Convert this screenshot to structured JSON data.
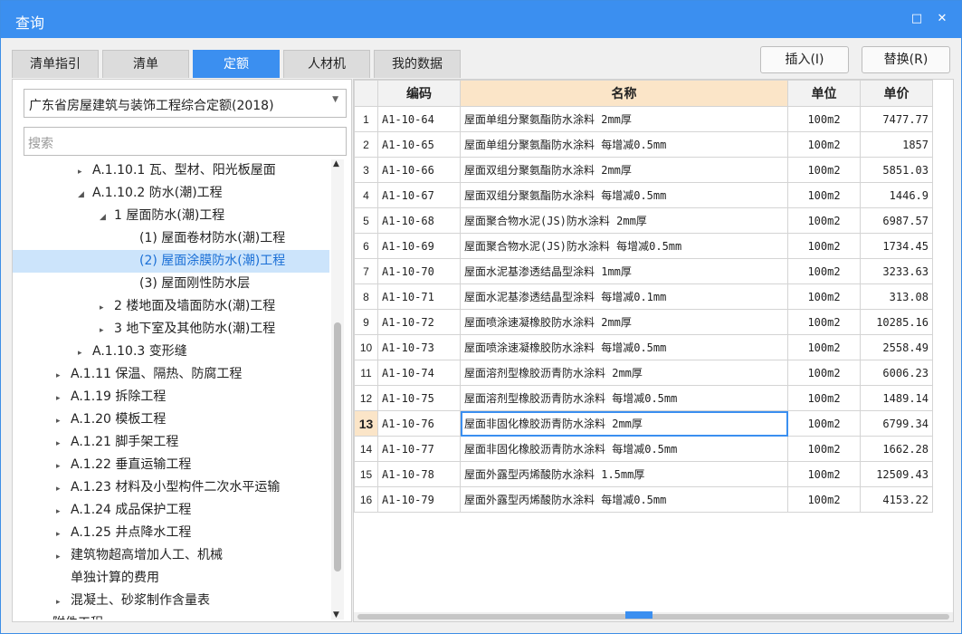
{
  "window": {
    "title": "查询",
    "maximize_icon": "□",
    "close_icon": "✕"
  },
  "tabs": [
    {
      "label": "清单指引"
    },
    {
      "label": "清单"
    },
    {
      "label": "定额",
      "active": true
    },
    {
      "label": "人材机"
    },
    {
      "label": "我的数据"
    }
  ],
  "toolbar": {
    "insert_label": "插入(I)",
    "replace_label": "替换(R)"
  },
  "left": {
    "library_select": "广东省房屋建筑与装饰工程综合定额(2018)",
    "search_placeholder": "搜索",
    "tree": [
      {
        "label": "A.1.10.1 瓦、型材、阳光板屋面",
        "level": 2,
        "arrow": "▸"
      },
      {
        "label": "A.1.10.2 防水(潮)工程",
        "level": 2,
        "arrow": "◢"
      },
      {
        "label": "1 屋面防水(潮)工程",
        "level": 3,
        "arrow": "◢"
      },
      {
        "label": "(1) 屋面卷材防水(潮)工程",
        "level": 4,
        "arrow": ""
      },
      {
        "label": "(2) 屋面涂膜防水(潮)工程",
        "level": 4,
        "arrow": "",
        "selected": true
      },
      {
        "label": "(3) 屋面刚性防水层",
        "level": 4,
        "arrow": ""
      },
      {
        "label": "2 楼地面及墙面防水(潮)工程",
        "level": 3,
        "arrow": "▸"
      },
      {
        "label": "3 地下室及其他防水(潮)工程",
        "level": 3,
        "arrow": "▸"
      },
      {
        "label": "A.1.10.3 变形缝",
        "level": 2,
        "arrow": "▸"
      },
      {
        "label": "A.1.11 保温、隔热、防腐工程",
        "level": 1,
        "arrow": "▸"
      },
      {
        "label": "A.1.19 拆除工程",
        "level": 1,
        "arrow": "▸"
      },
      {
        "label": "A.1.20 模板工程",
        "level": 1,
        "arrow": "▸"
      },
      {
        "label": "A.1.21 脚手架工程",
        "level": 1,
        "arrow": "▸"
      },
      {
        "label": "A.1.22 垂直运输工程",
        "level": 1,
        "arrow": "▸"
      },
      {
        "label": "A.1.23 材料及小型构件二次水平运输",
        "level": 1,
        "arrow": "▸"
      },
      {
        "label": "A.1.24 成品保护工程",
        "level": 1,
        "arrow": "▸"
      },
      {
        "label": "A.1.25 井点降水工程",
        "level": 1,
        "arrow": "▸"
      },
      {
        "label": "建筑物超高增加人工、机械",
        "level": 1,
        "arrow": "▸"
      },
      {
        "label": "单独计算的费用",
        "level": 1,
        "arrow": ""
      },
      {
        "label": "混凝土、砂浆制作含量表",
        "level": 1,
        "arrow": "▸"
      },
      {
        "label": "附件工程",
        "level": 0,
        "arrow": ""
      }
    ]
  },
  "grid": {
    "columns": [
      "",
      "编码",
      "名称",
      "单位",
      "单价"
    ],
    "active_row": 13,
    "rows": [
      {
        "n": "1",
        "code": "A1-10-64",
        "name": "屋面单组分聚氨酯防水涂料 2mm厚",
        "unit": "100m2",
        "price": "7477.77"
      },
      {
        "n": "2",
        "code": "A1-10-65",
        "name": "屋面单组分聚氨酯防水涂料 每增减0.5mm",
        "unit": "100m2",
        "price": "1857"
      },
      {
        "n": "3",
        "code": "A1-10-66",
        "name": "屋面双组分聚氨酯防水涂料 2mm厚",
        "unit": "100m2",
        "price": "5851.03"
      },
      {
        "n": "4",
        "code": "A1-10-67",
        "name": "屋面双组分聚氨酯防水涂料 每增减0.5mm",
        "unit": "100m2",
        "price": "1446.9"
      },
      {
        "n": "5",
        "code": "A1-10-68",
        "name": "屋面聚合物水泥(JS)防水涂料 2mm厚",
        "unit": "100m2",
        "price": "6987.57"
      },
      {
        "n": "6",
        "code": "A1-10-69",
        "name": "屋面聚合物水泥(JS)防水涂料 每增减0.5mm",
        "unit": "100m2",
        "price": "1734.45"
      },
      {
        "n": "7",
        "code": "A1-10-70",
        "name": "屋面水泥基渗透结晶型涂料 1mm厚",
        "unit": "100m2",
        "price": "3233.63"
      },
      {
        "n": "8",
        "code": "A1-10-71",
        "name": "屋面水泥基渗透结晶型涂料 每增减0.1mm",
        "unit": "100m2",
        "price": "313.08"
      },
      {
        "n": "9",
        "code": "A1-10-72",
        "name": "屋面喷涂速凝橡胶防水涂料 2mm厚",
        "unit": "100m2",
        "price": "10285.16"
      },
      {
        "n": "10",
        "code": "A1-10-73",
        "name": "屋面喷涂速凝橡胶防水涂料 每增减0.5mm",
        "unit": "100m2",
        "price": "2558.49"
      },
      {
        "n": "11",
        "code": "A1-10-74",
        "name": "屋面溶剂型橡胶沥青防水涂料 2mm厚",
        "unit": "100m2",
        "price": "6006.23"
      },
      {
        "n": "12",
        "code": "A1-10-75",
        "name": "屋面溶剂型橡胶沥青防水涂料 每增减0.5mm",
        "unit": "100m2",
        "price": "1489.14"
      },
      {
        "n": "13",
        "code": "A1-10-76",
        "name": "屋面非固化橡胶沥青防水涂料 2mm厚",
        "unit": "100m2",
        "price": "6799.34"
      },
      {
        "n": "14",
        "code": "A1-10-77",
        "name": "屋面非固化橡胶沥青防水涂料 每增减0.5mm",
        "unit": "100m2",
        "price": "1662.28"
      },
      {
        "n": "15",
        "code": "A1-10-78",
        "name": "屋面外露型丙烯酸防水涂料 1.5mm厚",
        "unit": "100m2",
        "price": "12509.43"
      },
      {
        "n": "16",
        "code": "A1-10-79",
        "name": "屋面外露型丙烯酸防水涂料 每增减0.5mm",
        "unit": "100m2",
        "price": "4153.22"
      }
    ]
  }
}
